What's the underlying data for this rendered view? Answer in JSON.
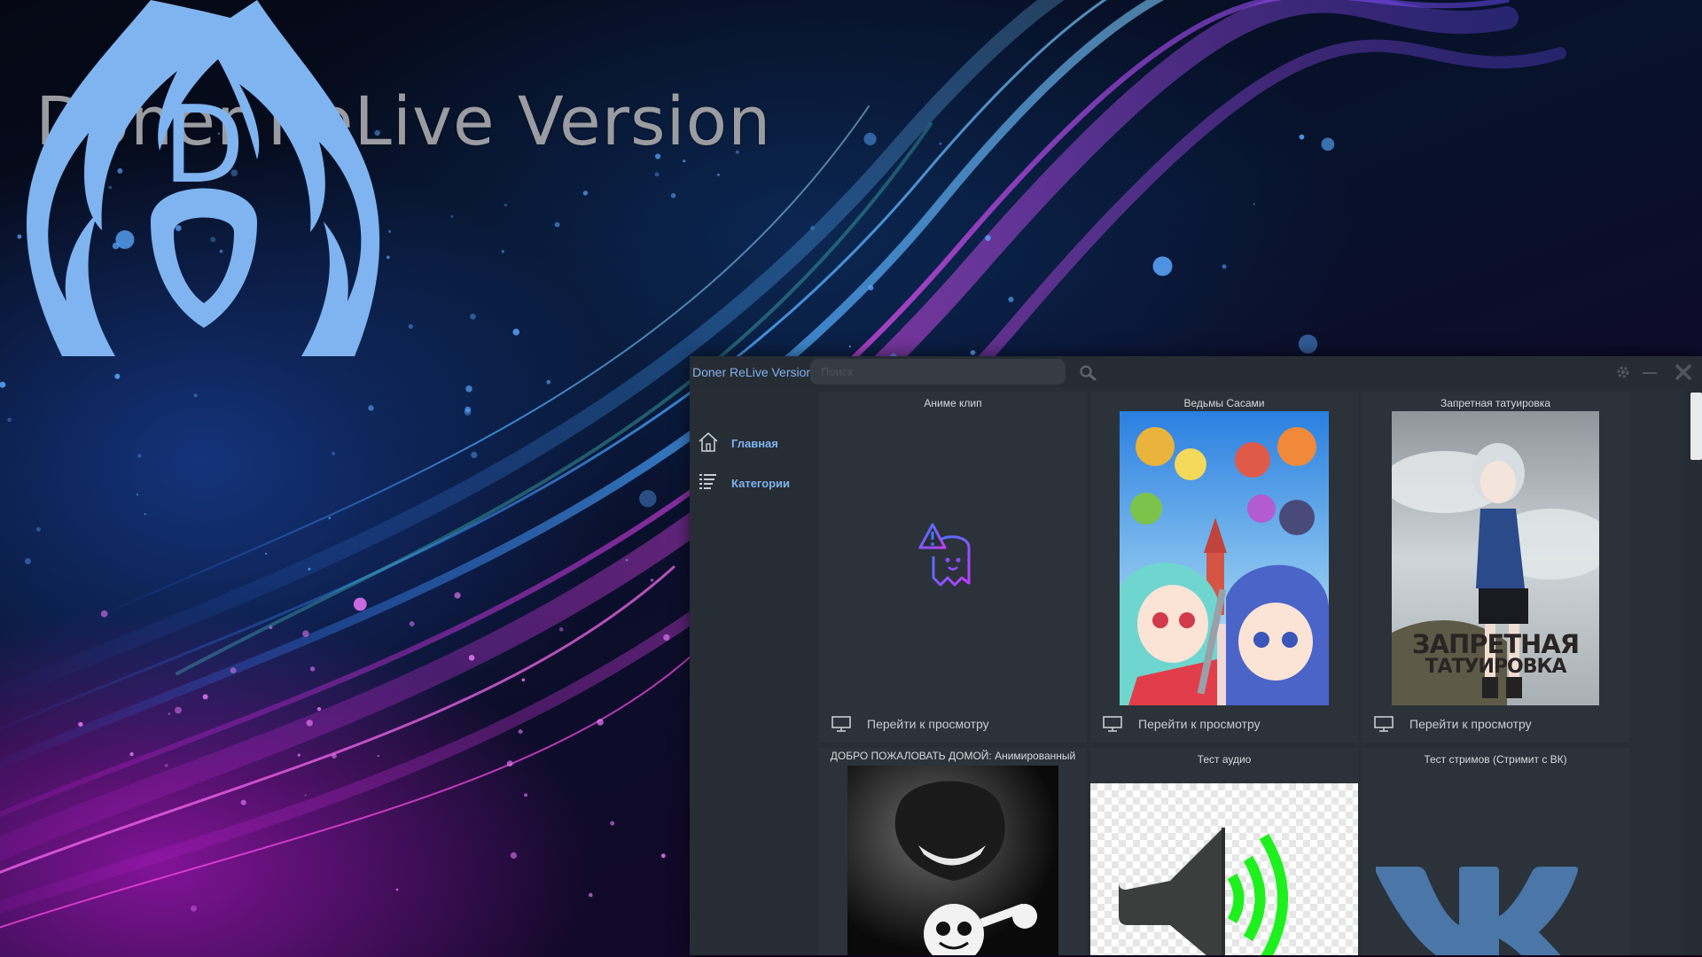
{
  "desktop": {
    "title": "Doner ReLive Version",
    "logo_letter": "D",
    "logo_color": "#7fb4f0"
  },
  "window": {
    "title": "Doner ReLive Version",
    "search": {
      "placeholder": "Поиск",
      "value": ""
    },
    "controls": [
      "settings-icon",
      "minimize-icon",
      "close-icon"
    ]
  },
  "sidebar": {
    "items": [
      {
        "label": "Главная",
        "icon": "home-icon"
      },
      {
        "label": "Категории",
        "icon": "list-icon"
      }
    ]
  },
  "cards": [
    {
      "title": "Аниме клип",
      "watch_label": "Перейти к просмотру",
      "poster": "broken-image-ghost-icon"
    },
    {
      "title": "Ведьмы Сасами",
      "watch_label": "Перейти к просмотру",
      "poster": "anime-poster"
    },
    {
      "title": "Запретная татуировка",
      "watch_label": "Перейти к просмотру",
      "poster": "anime-poster",
      "poster_text": [
        "ЗАПРЕТНАЯ",
        "ТАТУИРОВКА"
      ]
    },
    {
      "title": "ДОБРО ПОЖАЛОВАТЬ ДОМОЙ: Анимированный",
      "poster": "cartoon-poster"
    },
    {
      "title": "Тест аудио",
      "poster": "speaker-icon"
    },
    {
      "title": "Тест стримов (Стримит с ВК)",
      "poster": "vk-logo"
    }
  ],
  "colors": {
    "accent": "#7fb2ee",
    "window_bg": "#282e35",
    "card_bg": "#2b323a",
    "sound_waves": "#1ef01e"
  }
}
